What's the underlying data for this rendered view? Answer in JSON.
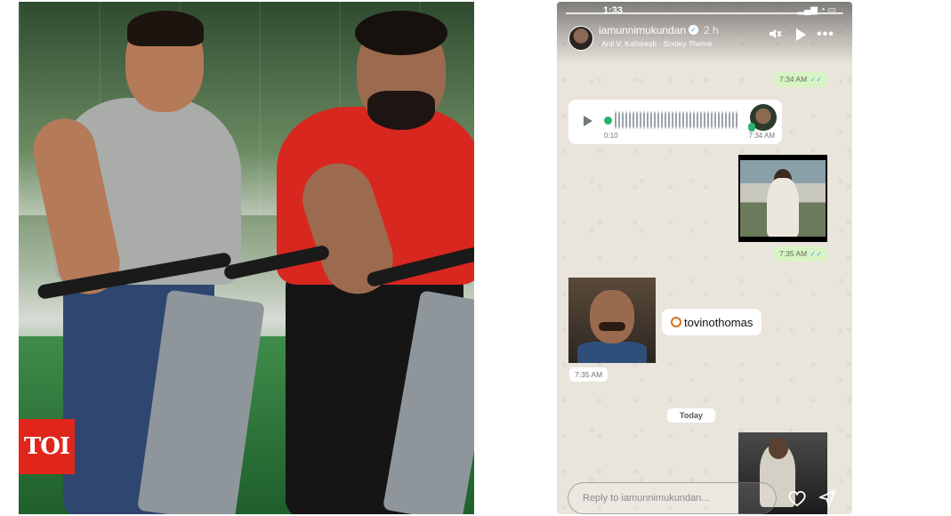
{
  "brand": {
    "logo_text": "TOI",
    "logo_color": "#e0261b"
  },
  "story": {
    "status_time": "1:33",
    "username": "iamunnimukundan",
    "time_ago": "2 h",
    "music": "Anil V. Kathiresh · Sooley Theme",
    "reply_placeholder": "Reply to iamunnimukundan...",
    "icons": [
      "mute-icon",
      "play-icon",
      "more-icon",
      "heart-icon",
      "send-icon",
      "verified-icon"
    ]
  },
  "chat": {
    "messages": [
      {
        "type": "time",
        "time": "7:34 AM",
        "ticks": "✓✓"
      },
      {
        "type": "voice",
        "duration": "0:10",
        "time": "7:34 AM"
      },
      {
        "type": "image",
        "time": "7:35 AM",
        "ticks": "✓✓"
      },
      {
        "type": "mention",
        "text": "tovinothomas",
        "time": "7:35 AM"
      }
    ],
    "date_divider": "Today",
    "tick_color": "#34b7f1",
    "bubble_out_color": "#d9f4c4"
  }
}
